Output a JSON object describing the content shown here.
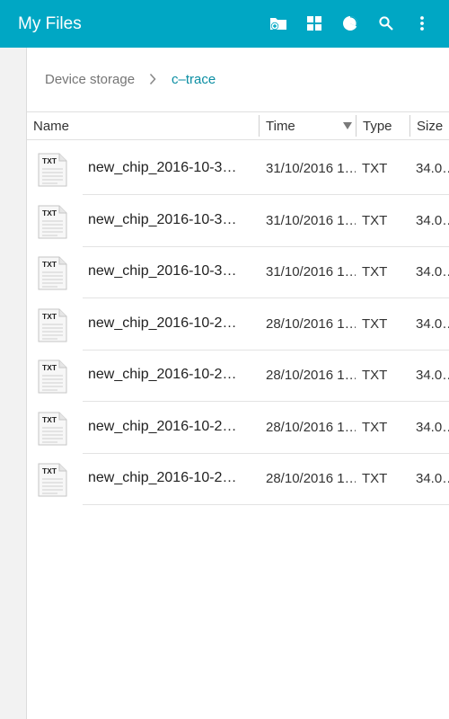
{
  "app": {
    "title": "My Files"
  },
  "toolbar": {
    "icons": [
      "new-folder-icon",
      "grid-view-icon",
      "storage-usage-icon",
      "search-icon",
      "more-options-icon"
    ]
  },
  "breadcrumb": {
    "root": "Device storage",
    "current": "c–trace"
  },
  "columns": {
    "name": "Name",
    "time": "Time",
    "type": "Type",
    "size": "Size"
  },
  "files": [
    {
      "badge": "TXT",
      "name": "new_chip_2016-10-3…",
      "time": "31/10/2016 1…",
      "type": "TXT",
      "size": "34.0…"
    },
    {
      "badge": "TXT",
      "name": "new_chip_2016-10-3…",
      "time": "31/10/2016 1…",
      "type": "TXT",
      "size": "34.0…"
    },
    {
      "badge": "TXT",
      "name": "new_chip_2016-10-3…",
      "time": "31/10/2016 1…",
      "type": "TXT",
      "size": "34.0…"
    },
    {
      "badge": "TXT",
      "name": "new_chip_2016-10-2…",
      "time": "28/10/2016 1…",
      "type": "TXT",
      "size": "34.0…"
    },
    {
      "badge": "TXT",
      "name": "new_chip_2016-10-2…",
      "time": "28/10/2016 1…",
      "type": "TXT",
      "size": "34.0…"
    },
    {
      "badge": "TXT",
      "name": "new_chip_2016-10-2…",
      "time": "28/10/2016 1…",
      "type": "TXT",
      "size": "34.0…"
    },
    {
      "badge": "TXT",
      "name": "new_chip_2016-10-2…",
      "time": "28/10/2016 1…",
      "type": "TXT",
      "size": "34.0…"
    }
  ],
  "colors": {
    "appbar": "#00a7c4",
    "accent": "#0b8ea3"
  }
}
